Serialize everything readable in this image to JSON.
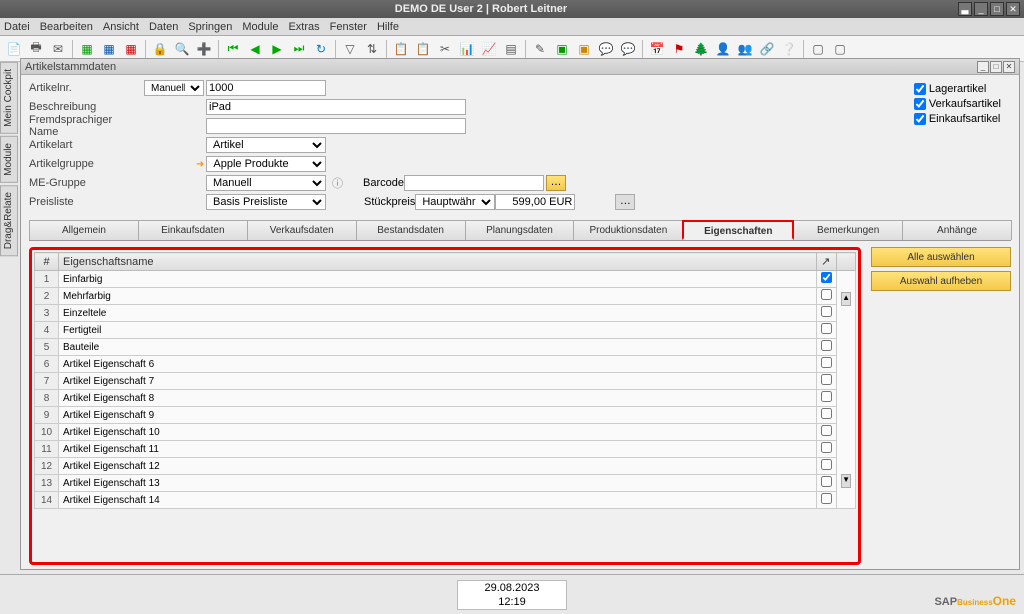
{
  "titlebar": {
    "text": "DEMO DE User 2 | Robert Leitner"
  },
  "menu": [
    "Datei",
    "Bearbeiten",
    "Ansicht",
    "Daten",
    "Springen",
    "Module",
    "Extras",
    "Fenster",
    "Hilfe"
  ],
  "window_title": "Artikelstammdaten",
  "form": {
    "artikelnr_label": "Artikelnr.",
    "artikelnr_mode": "Manuell",
    "artikelnr_value": "1000",
    "beschreibung_label": "Beschreibung",
    "beschreibung_value": "iPad",
    "fremd_label": "Fremdsprachiger Name",
    "fremd_value": "",
    "artikelart_label": "Artikelart",
    "artikelart_value": "Artikel",
    "artikelgruppe_label": "Artikelgruppe",
    "artikelgruppe_value": "Apple Produkte",
    "megruppe_label": "ME-Gruppe",
    "megruppe_value": "Manuell",
    "preisliste_label": "Preisliste",
    "preisliste_value": "Basis Preisliste",
    "barcode_label": "Barcode",
    "barcode_value": "",
    "stueckpreis_label": "Stückpreis",
    "stueckpreis_curr": "Hauptwährung",
    "stueckpreis_value": "599,00 EUR"
  },
  "checks": {
    "lager": "Lagerartikel",
    "verkauf": "Verkaufsartikel",
    "einkauf": "Einkaufsartikel"
  },
  "tabs": [
    "Allgemein",
    "Einkaufsdaten",
    "Verkaufsdaten",
    "Bestandsdaten",
    "Planungsdaten",
    "Produktionsdaten",
    "Eigenschaften",
    "Bemerkungen",
    "Anhänge"
  ],
  "active_tab_index": 6,
  "props_header": {
    "num": "#",
    "name": "Eigenschaftsname"
  },
  "props": [
    {
      "n": 1,
      "name": "Einfarbig",
      "chk": true
    },
    {
      "n": 2,
      "name": "Mehrfarbig",
      "chk": false
    },
    {
      "n": 3,
      "name": "Einzeltele",
      "chk": false
    },
    {
      "n": 4,
      "name": "Fertigteil",
      "chk": false
    },
    {
      "n": 5,
      "name": "Bauteile",
      "chk": false
    },
    {
      "n": 6,
      "name": "Artikel Eigenschaft 6",
      "chk": false
    },
    {
      "n": 7,
      "name": "Artikel Eigenschaft 7",
      "chk": false
    },
    {
      "n": 8,
      "name": "Artikel Eigenschaft 8",
      "chk": false
    },
    {
      "n": 9,
      "name": "Artikel Eigenschaft 9",
      "chk": false
    },
    {
      "n": 10,
      "name": "Artikel Eigenschaft 10",
      "chk": false
    },
    {
      "n": 11,
      "name": "Artikel Eigenschaft 11",
      "chk": false
    },
    {
      "n": 12,
      "name": "Artikel Eigenschaft 12",
      "chk": false
    },
    {
      "n": 13,
      "name": "Artikel Eigenschaft 13",
      "chk": false
    },
    {
      "n": 14,
      "name": "Artikel Eigenschaft 14",
      "chk": false
    }
  ],
  "side_buttons": {
    "select_all": "Alle auswählen",
    "deselect": "Auswahl aufheben"
  },
  "sidetabs": [
    "Mein Cockpit",
    "Module",
    "Drag&Relate"
  ],
  "status": {
    "date": "29.08.2023",
    "time": "12:19"
  },
  "logo": {
    "main": "SAP",
    "sub": "Business",
    "one": "One"
  }
}
